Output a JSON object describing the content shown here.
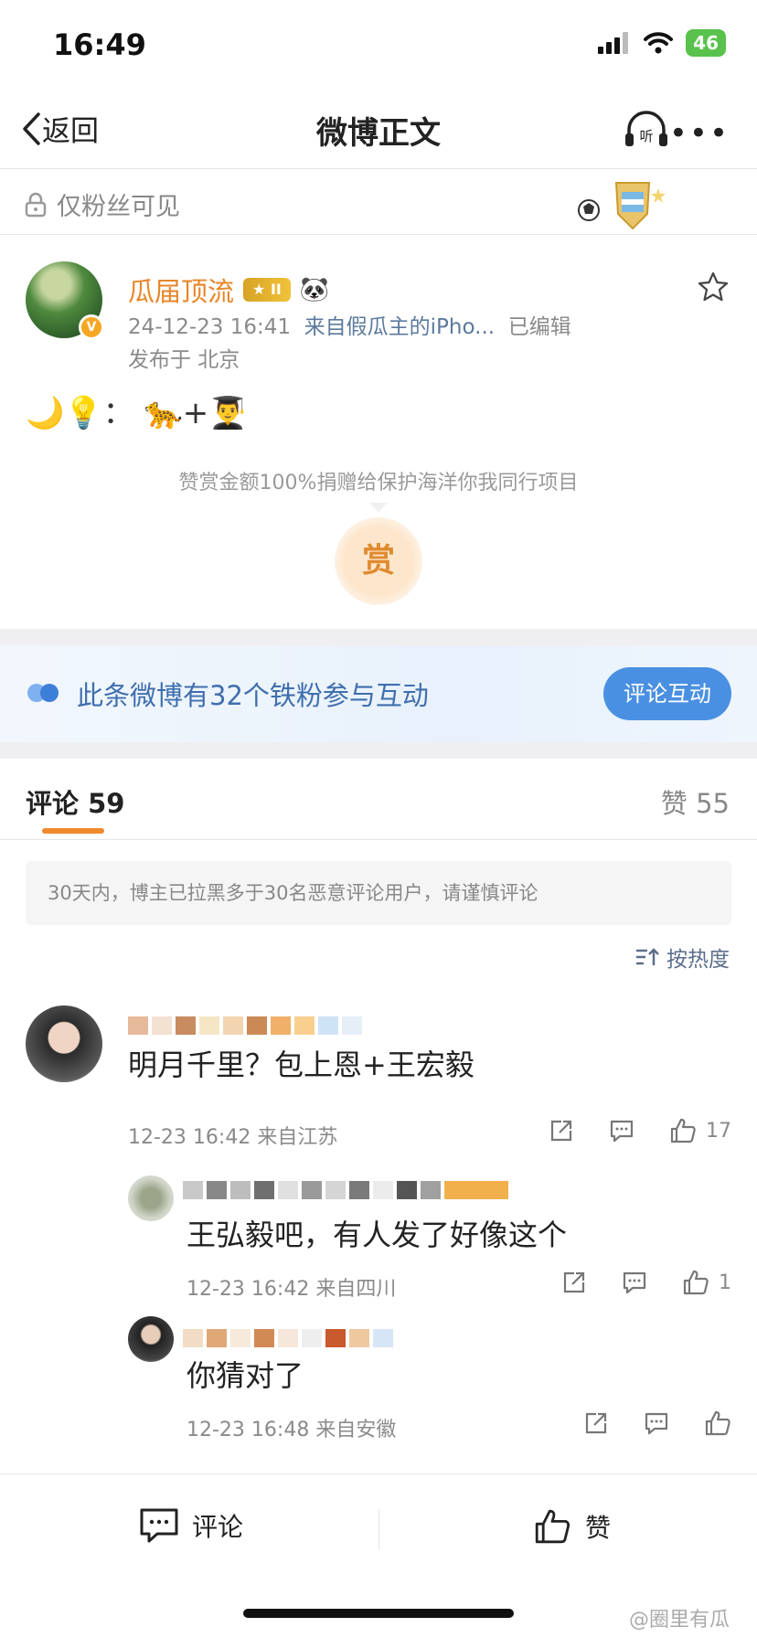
{
  "status_bar": {
    "time": "16:49",
    "battery": "46"
  },
  "nav": {
    "back_label": "返回",
    "title": "微博正文",
    "listen_label": "听"
  },
  "visibility": {
    "label": "仅粉丝可见"
  },
  "post": {
    "username": "瓜届顶流",
    "level_badge": "II",
    "timestamp": "24-12-23 16:41",
    "source": "来自假瓜主的iPho...",
    "edited": "已编辑",
    "location": "发布于 北京",
    "body": "🌙💡： 🐆+👨‍🎓"
  },
  "reward": {
    "text": "赞赏金额100%捐赠给保护海洋你我同行项目",
    "button": "赏"
  },
  "banner": {
    "text": "此条微博有32个铁粉参与互动",
    "button": "评论互动"
  },
  "tabs": {
    "comments": "评论 59",
    "likes": "赞 55"
  },
  "notice": "30天内，博主已拉黑多于30名恶意评论用户，请谨慎评论",
  "sort_label": "按热度",
  "comments": [
    {
      "text": "明月千里？包上恩+王宏毅",
      "meta": "12-23 16:42 来自江苏",
      "likes": "17"
    },
    {
      "text": "王弘毅吧，有人发了好像这个",
      "meta": "12-23 16:42 来自四川",
      "likes": "1"
    },
    {
      "text": "你猜对了",
      "meta": "12-23 16:48 来自安徽",
      "likes": ""
    }
  ],
  "bottom_bar": {
    "comment_label": "评论",
    "like_label": "赞"
  },
  "watermark": "@圈里有瓜",
  "colors": {
    "accent": "#ef8a2c",
    "link": "#5c7a9e",
    "banner_button": "#4a90e2"
  }
}
